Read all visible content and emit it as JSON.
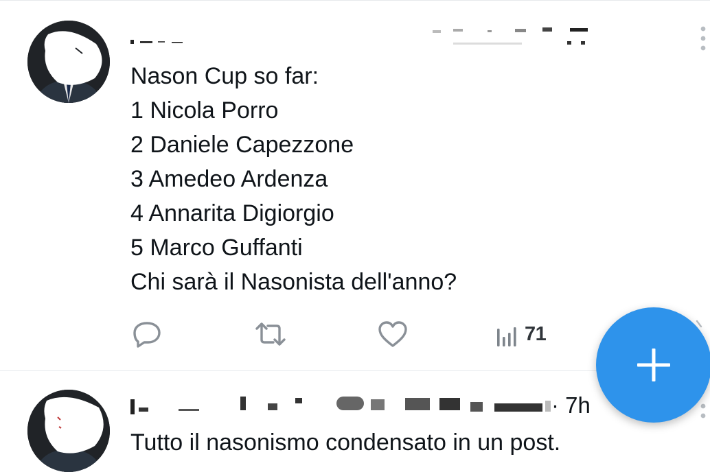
{
  "tweets": [
    {
      "lines": [
        "Nason Cup so far:",
        "1 Nicola Porro",
        "2 Daniele Capezzone",
        "3 Amedeo Ardenza",
        "4 Annarita Digiorgio",
        "5 Marco Guffanti",
        "Chi sarà il Nasonista dell'anno?"
      ],
      "actions": {
        "reply_icon": "reply-icon",
        "retweet_icon": "retweet-icon",
        "like_icon": "heart-icon",
        "views_icon": "views-chart-icon",
        "views_count": "71"
      }
    },
    {
      "timestamp": "· 7h",
      "text": "Tutto il nasonismo condensato in un post."
    }
  ],
  "fab": {
    "icon": "plus-icon"
  },
  "colors": {
    "fab": "#2e93eb",
    "icon_gray": "#8a9097",
    "text": "#0f1419",
    "divider": "#e6e9ec"
  }
}
